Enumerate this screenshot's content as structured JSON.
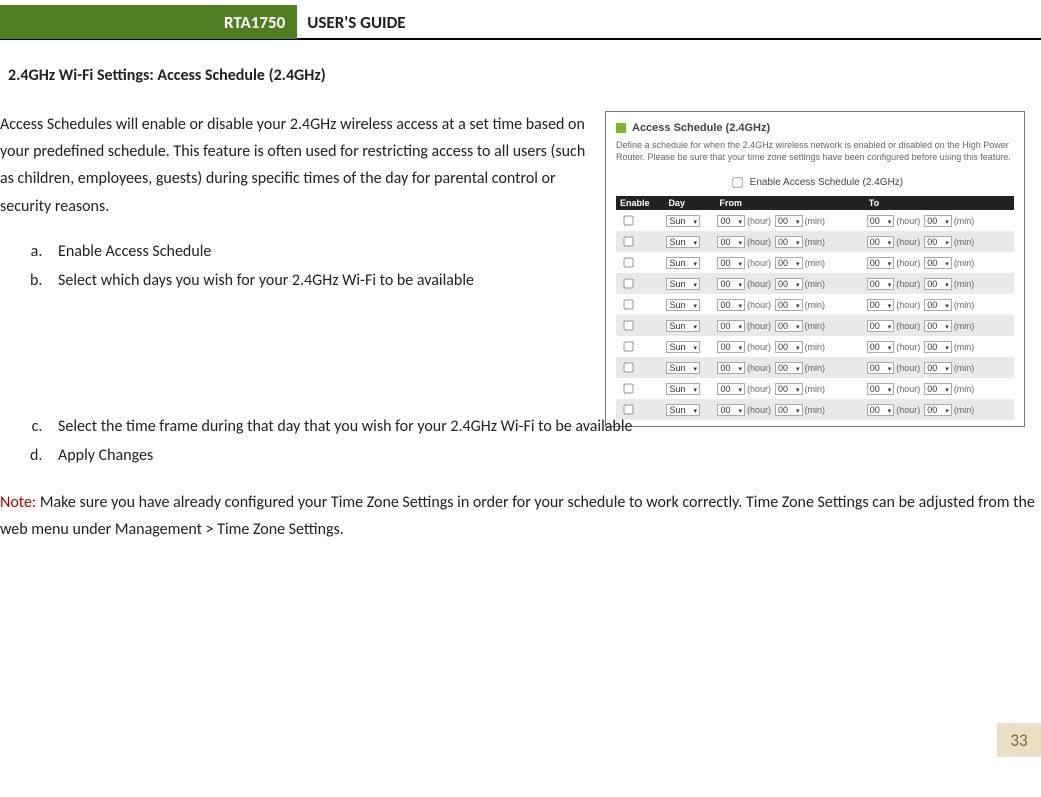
{
  "header": {
    "product": "RTA1750",
    "title": "USER'S GUIDE"
  },
  "section_title": "2.4GHz Wi-Fi Settings: Access Schedule (2.4GHz)",
  "description": "Access Schedules will enable or disable your 2.4GHz wireless access at a set time based on your predefined schedule.  This feature is often used for restricting access to all users (such as children, employees, guests) during specific times of the day for parental control or security reasons.",
  "steps": {
    "a": "Enable Access Schedule",
    "b": "Select which days you wish for your 2.4GHz Wi-Fi to be available",
    "c": "Select the time frame during that day that you wish for your 2.4GHz Wi-Fi to be available",
    "d": "Apply Changes"
  },
  "note": {
    "label": "Note:",
    "text": "  Make sure you have already configured your Time Zone Settings in order for your schedule to work correctly.  Time Zone Settings can be adjusted from the web menu under Management > Time Zone Settings."
  },
  "figure": {
    "title": "Access Schedule (2.4GHz)",
    "desc": "Define a schedule for when the 2.4GHz wireless network is enabled or disabled on the High Power Router. Please be sure that your time zone settings have been configured before using this feature.",
    "enable_label": "Enable Access Schedule (2.4GHz)",
    "cols": {
      "enable": "Enable",
      "day": "Day",
      "from": "From",
      "to": "To"
    },
    "day_val": "Sun",
    "hh": "00",
    "mm": "00",
    "hour_label": "(hour)",
    "min_label": "(min)",
    "rows": 10
  },
  "page_number": "33"
}
